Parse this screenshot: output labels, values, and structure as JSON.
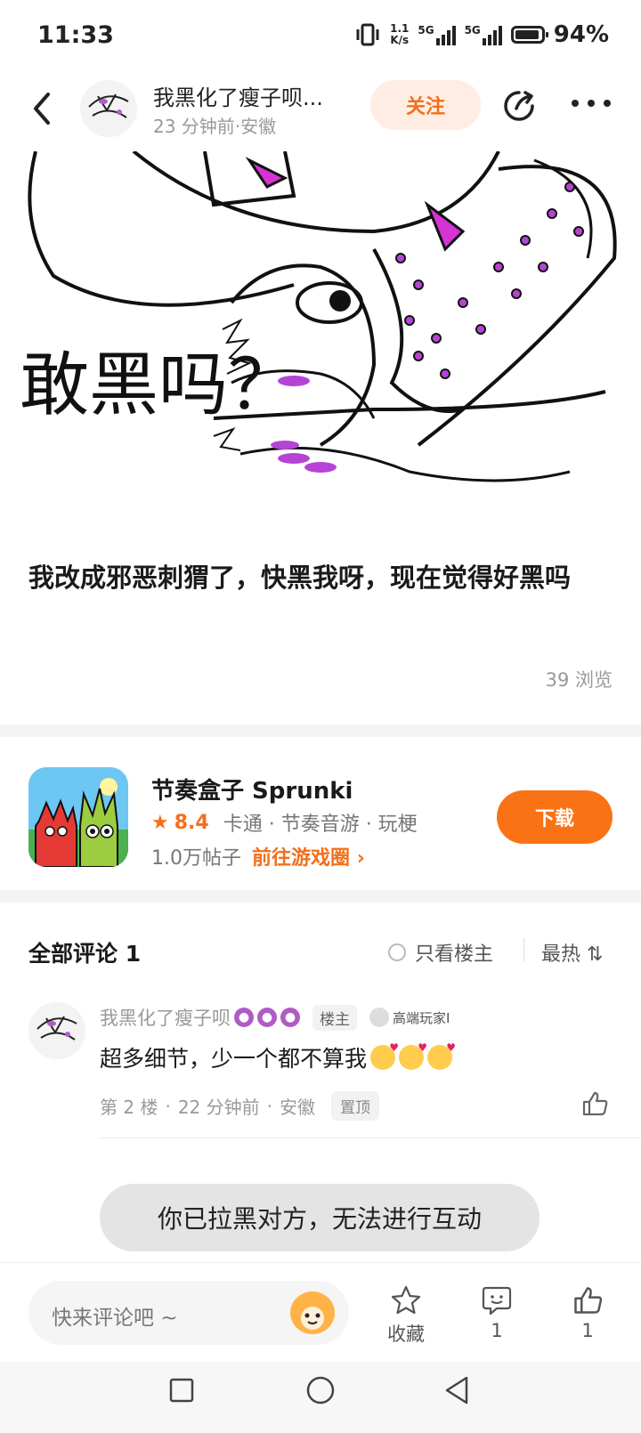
{
  "status_bar": {
    "time": "11:33",
    "net_speed_value": "1.1",
    "net_speed_unit": "K/s",
    "network_1": "5G",
    "network_2": "5G",
    "battery": "94%"
  },
  "header": {
    "author_name": "我黑化了瘦子呗...",
    "post_meta": "23 分钟前·安徽",
    "follow_label": "关注"
  },
  "post": {
    "image_caption": "敢黑吗？",
    "text": "我改成邪恶刺猬了，快黑我呀，现在觉得好黑吗",
    "views": "39 浏览"
  },
  "game_card": {
    "title": "节奏盒子 Sprunki",
    "rating": "8.4",
    "tags": "卡通 · 节奏音游 · 玩梗",
    "posts_count": "1.0万帖子",
    "goto_label": "前往游戏圈",
    "download_label": "下载",
    "accent_color": "#f97316"
  },
  "comments": {
    "title": "全部评论 1",
    "only_op_label": "只看楼主",
    "sort_label": "最热",
    "items": [
      {
        "author": "我黑化了瘦子呗",
        "op_badge": "楼主",
        "level_badge": "高端玩家I",
        "body": "超多细节，少一个都不算我",
        "floor": "第 2 楼",
        "time": "22 分钟前",
        "location": "安徽",
        "pin_label": "置顶"
      }
    ]
  },
  "toast": "你已拉黑对方，无法进行互动",
  "bottom_bar": {
    "comment_placeholder": "快来评论吧 ~",
    "favorite_label": "收藏",
    "comments_count": "1",
    "likes_count": "1"
  }
}
